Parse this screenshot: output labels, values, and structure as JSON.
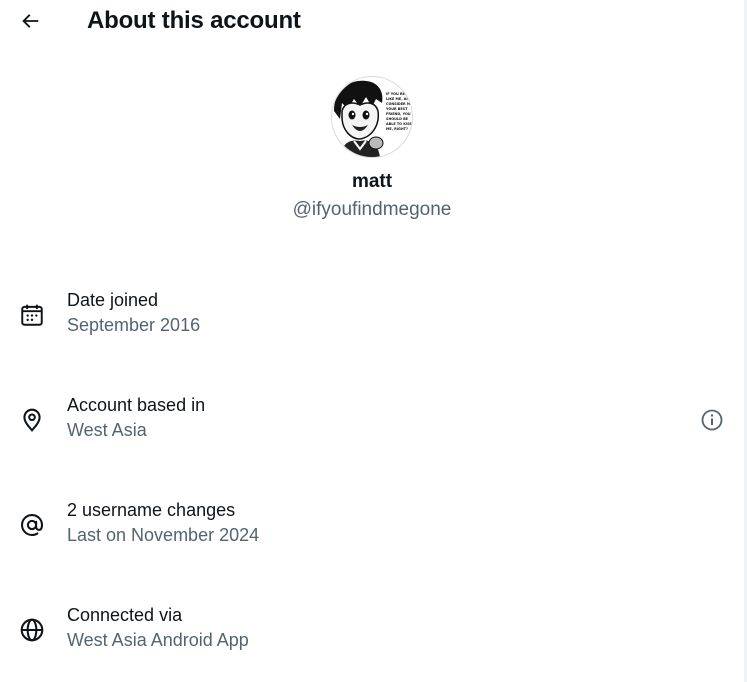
{
  "header": {
    "title": "About this account",
    "back_icon": "arrow-left-icon"
  },
  "profile": {
    "display_name": "matt",
    "handle": "@ifyoufindmegone",
    "avatar_speech_text": "IF YOU REALLY LIKE ME, AND CONSIDER ME YOUR BEST FRIEND, YOU SHOULD BE ABLE TO KISS ME, RIGHT?"
  },
  "rows": [
    {
      "icon": "calendar-icon",
      "title": "Date joined",
      "value": "September 2016"
    },
    {
      "icon": "location-pin-icon",
      "title": "Account based in",
      "value": "West Asia",
      "action_icon": "info-circle-icon"
    },
    {
      "icon": "at-sign-icon",
      "title": "2 username changes",
      "value": "Last on November 2024"
    },
    {
      "icon": "globe-icon",
      "title": "Connected via",
      "value": "West Asia Android App"
    }
  ],
  "colors": {
    "text_primary": "#0f1419",
    "text_secondary": "#536471",
    "background": "#ffffff"
  }
}
